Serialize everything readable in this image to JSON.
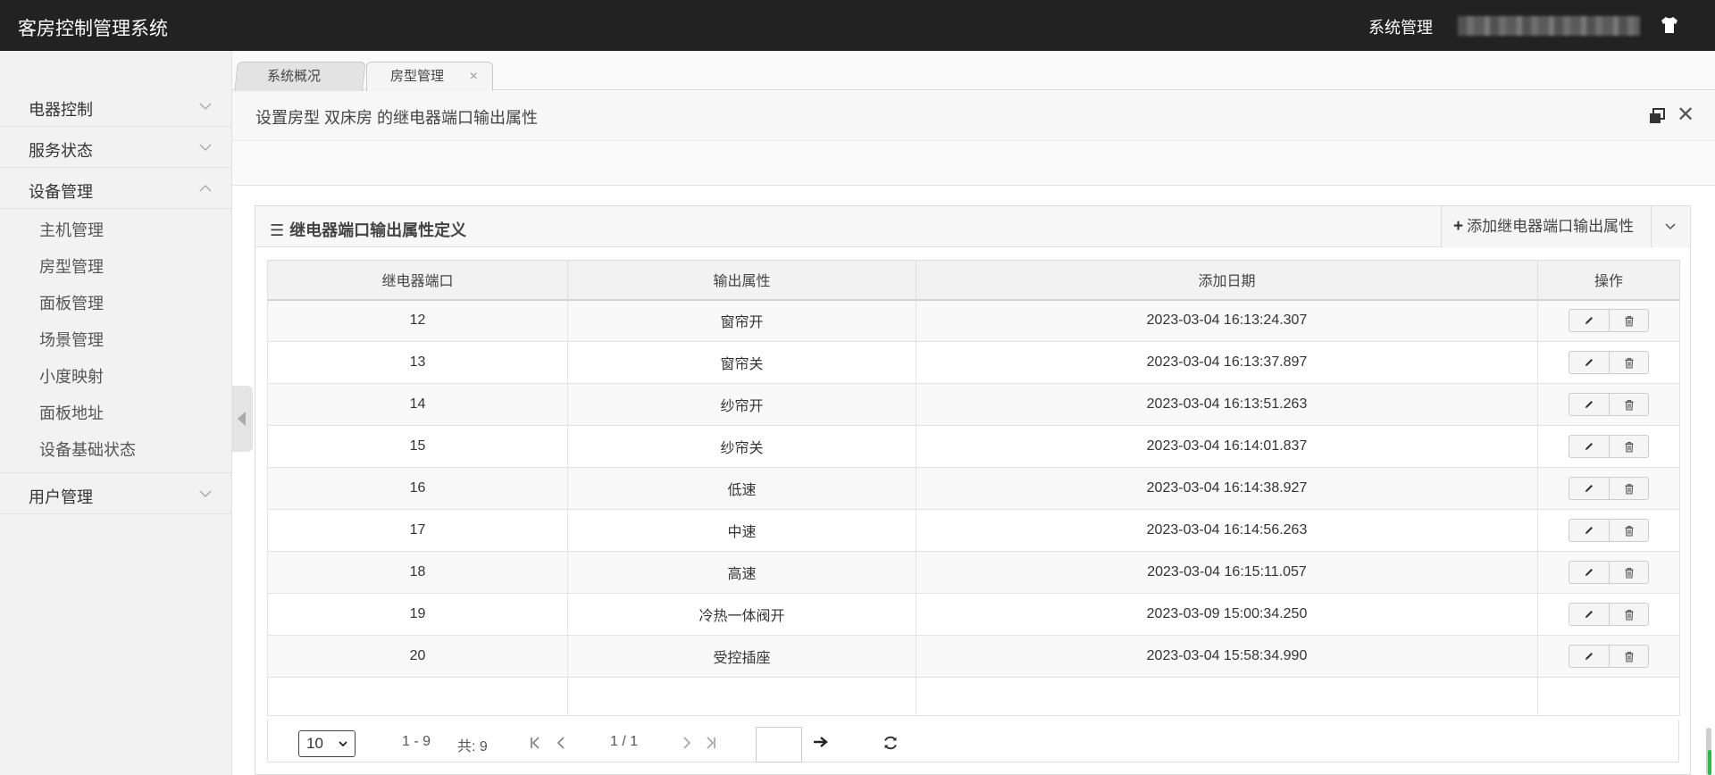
{
  "header": {
    "app_title": "客房控制管理系统",
    "system_menu": "系统管理",
    "user_icon": "shirt-icon"
  },
  "sidebar": {
    "groups": [
      {
        "label": "电器控制",
        "expanded": false
      },
      {
        "label": "服务状态",
        "expanded": false
      },
      {
        "label": "设备管理",
        "expanded": true,
        "items": [
          "主机管理",
          "房型管理",
          "面板管理",
          "场景管理",
          "小度映射",
          "面板地址",
          "设备基础状态"
        ]
      },
      {
        "label": "用户管理",
        "expanded": false
      }
    ]
  },
  "tabs": [
    {
      "label": "系统概况",
      "active": false
    },
    {
      "label": "房型管理",
      "active": true,
      "close": "×"
    }
  ],
  "content": {
    "title": "设置房型 双床房 的继电器端口输出属性"
  },
  "panel": {
    "title": "继电器端口输出属性定义",
    "add_button": "添加继电器端口输出属性",
    "columns": [
      "继电器端口",
      "输出属性",
      "添加日期",
      "操作"
    ],
    "rows": [
      {
        "port": "12",
        "attr": "窗帘开",
        "date": "2023-03-04 16:13:24.307"
      },
      {
        "port": "13",
        "attr": "窗帘关",
        "date": "2023-03-04 16:13:37.897"
      },
      {
        "port": "14",
        "attr": "纱帘开",
        "date": "2023-03-04 16:13:51.263"
      },
      {
        "port": "15",
        "attr": "纱帘关",
        "date": "2023-03-04 16:14:01.837"
      },
      {
        "port": "16",
        "attr": "低速",
        "date": "2023-03-04 16:14:38.927"
      },
      {
        "port": "17",
        "attr": "中速",
        "date": "2023-03-04 16:14:56.263"
      },
      {
        "port": "18",
        "attr": "高速",
        "date": "2023-03-04 16:15:11.057"
      },
      {
        "port": "19",
        "attr": "冷热一体阀开",
        "date": "2023-03-09 15:00:34.250"
      },
      {
        "port": "20",
        "attr": "受控插座",
        "date": "2023-03-04 15:58:34.990"
      }
    ]
  },
  "pager": {
    "page_size": "10",
    "range": "1 - 9",
    "total": "共: 9",
    "current": "1 / 1"
  },
  "colors": {
    "topbar_bg": "#222222",
    "sidebar_bg": "#f2f2f2",
    "scroll_accent": "#2db84d"
  }
}
